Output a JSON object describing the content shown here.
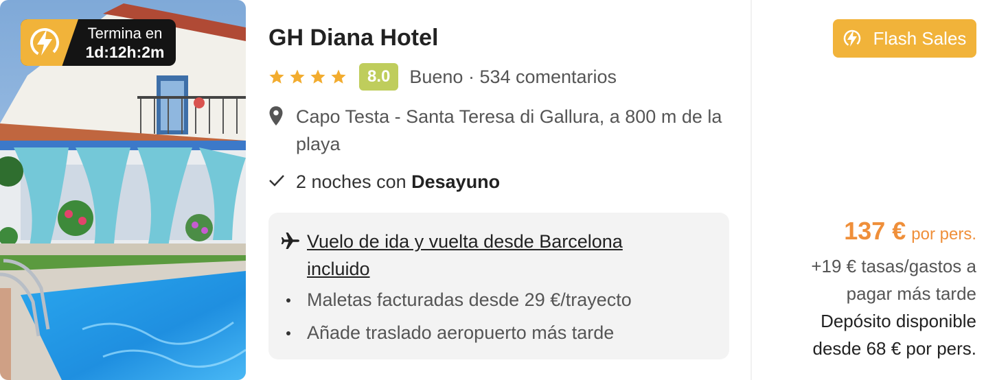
{
  "promo": {
    "timer_label": "Termina en",
    "timer_value": "1d:12h:2m"
  },
  "hotel": {
    "name": "GH Diana Hotel",
    "stars": 4,
    "score": "8.0",
    "rating_text": "Bueno · 534 comentarios",
    "location": "Capo Testa - Santa Teresa di Gallura, a 800 m de la playa",
    "nights_prefix": "2 noches con ",
    "nights_board": "Desayuno"
  },
  "flight": {
    "link_text": "Vuelo de ida y vuelta desde Barcelona incluido",
    "bullets": [
      "Maletas facturadas desde 29 €/trayecto",
      "Añade traslado aeropuerto más tarde"
    ]
  },
  "pricing": {
    "flash_sales_label": "Flash Sales",
    "price": "137 €",
    "per_person": "por pers.",
    "taxes": "+19 € tasas/gastos a pagar más tarde",
    "deposit": "Depósito disponible desde 68 € por pers."
  },
  "colors": {
    "accent": "#f1b33a",
    "price": "#ef8f3a",
    "score_bg": "#bfcd5c",
    "star": "#f2ac2f"
  },
  "icons": {
    "badge": "lightning-icon",
    "location": "map-pin-icon",
    "included": "check-icon",
    "flight": "airplane-icon",
    "flash_sales": "lightning-icon"
  }
}
